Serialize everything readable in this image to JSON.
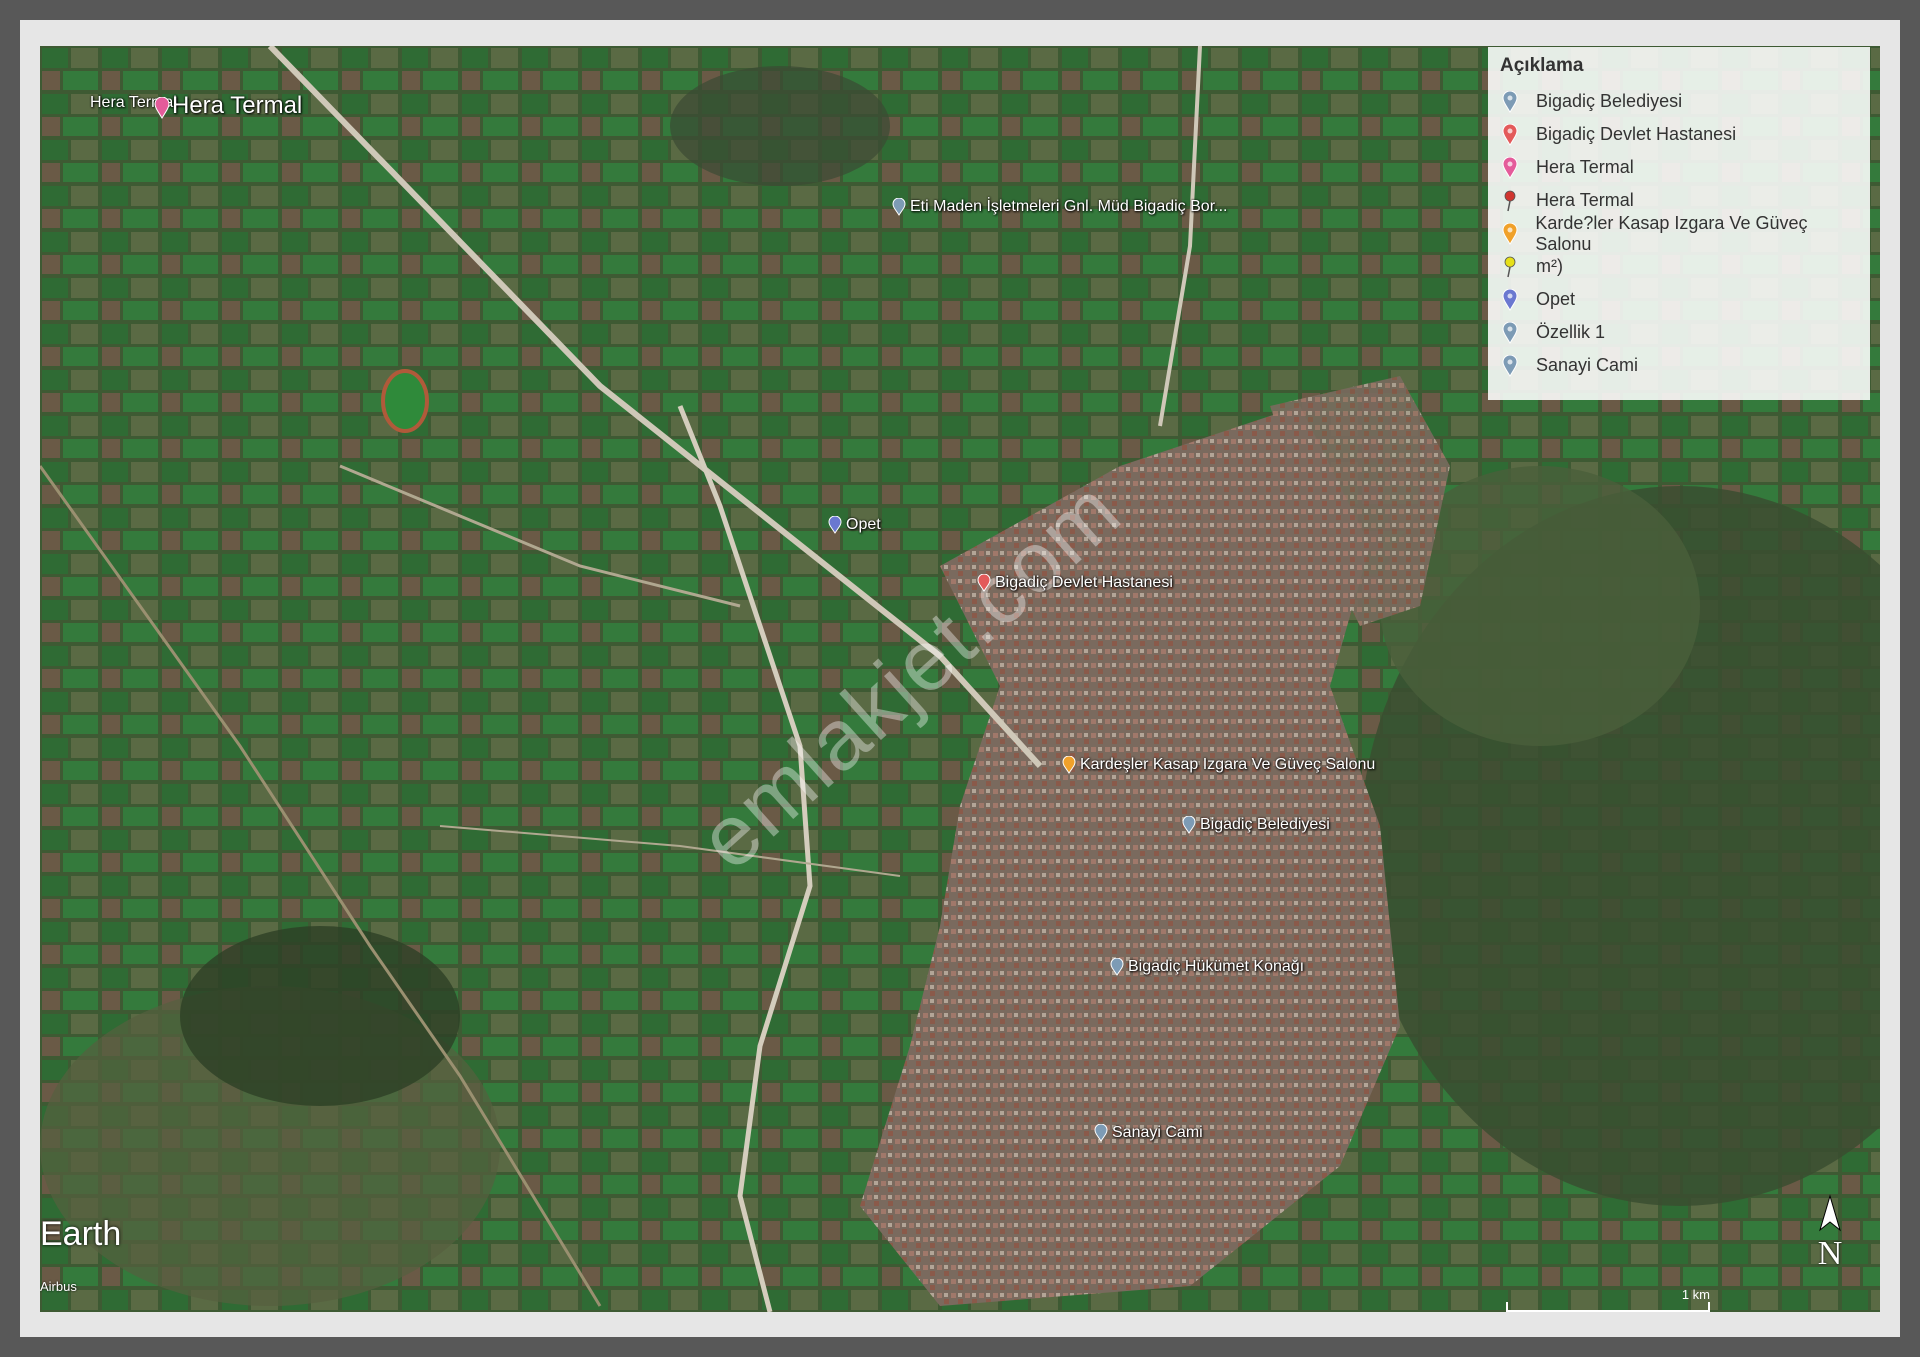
{
  "legend": {
    "title": "Açıklama",
    "items": [
      {
        "label": "Bigadiç Belediyesi",
        "color": "#7d9bb5",
        "icon": "pin-icon"
      },
      {
        "label": "Bigadiç Devlet Hastanesi",
        "color": "#e35a5a",
        "icon": "hospital-pin-icon"
      },
      {
        "label": "Hera Termal",
        "color": "#e45b9a",
        "icon": "pin-icon"
      },
      {
        "label": "Hera Termal",
        "color": "#d0352f",
        "icon": "pushpin-icon"
      },
      {
        "label": "Karde?ler Kasap Izgara Ve Güveç Salonu",
        "color": "#f0a12a",
        "icon": "pin-icon"
      },
      {
        "label": "m²)",
        "color": "#e6e018",
        "icon": "yellow-pushpin-icon"
      },
      {
        "label": "Opet",
        "color": "#6a78d0",
        "icon": "pin-icon"
      },
      {
        "label": "Özellik 1",
        "color": "#7d9bb5",
        "icon": "pin-icon"
      },
      {
        "label": "Sanayi Cami",
        "color": "#7d9bb5",
        "icon": "pin-icon"
      }
    ]
  },
  "places": {
    "hera_termal_small": "Hera Termal",
    "hera_termal_big": "Hera Termal",
    "eti_maden": "Eti Maden İşletmeleri Gnl. Müd Bigadiç Bor...",
    "opet": "Opet",
    "hastane": "Bigadiç Devlet Hastanesi",
    "kardesler": "Kardeşler Kasap Izgara Ve Güveç Salonu",
    "belediye": "Bigadiç Belediyesi",
    "hukumet": "Bigadiç Hükümet Konağı",
    "sanayi": "Sanayi Cami"
  },
  "watermark": "emlakjet.com",
  "attribution": {
    "earth": "Earth",
    "imagery": "Airbus"
  },
  "compass": "N",
  "scale_label": "1 km",
  "colors": {
    "frame": "#585858",
    "legend_bg": "#ffffff"
  }
}
